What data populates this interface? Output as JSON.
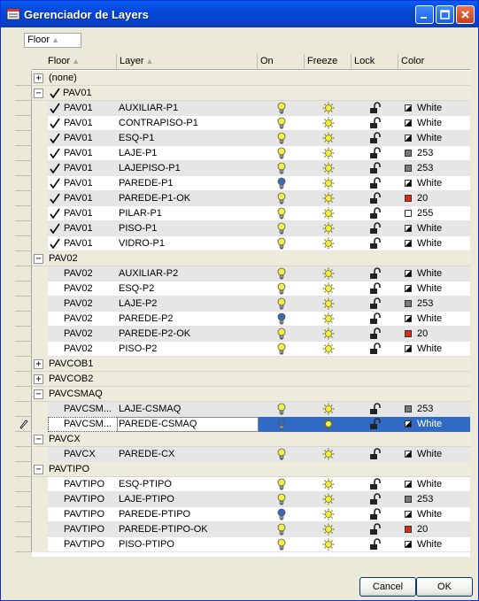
{
  "window": {
    "title": "Gerenciador de Layers"
  },
  "groupby": {
    "label": "Floor"
  },
  "columns": [
    "Floor",
    "Layer",
    "On",
    "Freeze",
    "Lock",
    "Color"
  ],
  "colors": {
    "titlebar": "#0a5cf0",
    "selection": "#316ac5",
    "bulb_on": "#f5f040",
    "bulb_off": "#2f6db8",
    "freeze": "#f5f040",
    "red": "#e02a10",
    "gray": "#7a7a7a"
  },
  "groups": [
    {
      "name": "(none)",
      "expanded": false,
      "checked": false,
      "rows": []
    },
    {
      "name": "PAV01",
      "expanded": true,
      "checked": true,
      "rows": [
        {
          "floor": "PAV01",
          "layer": "AUXILIAR-P1",
          "on": true,
          "color": "White",
          "swatch": "white"
        },
        {
          "floor": "PAV01",
          "layer": "CONTRAPISO-P1",
          "on": true,
          "color": "White",
          "swatch": "white"
        },
        {
          "floor": "PAV01",
          "layer": "ESQ-P1",
          "on": true,
          "color": "White",
          "swatch": "white"
        },
        {
          "floor": "PAV01",
          "layer": "LAJE-P1",
          "on": true,
          "color": "253",
          "swatch": "gray"
        },
        {
          "floor": "PAV01",
          "layer": "LAJEPISO-P1",
          "on": true,
          "color": "253",
          "swatch": "gray"
        },
        {
          "floor": "PAV01",
          "layer": "PAREDE-P1",
          "on": false,
          "color": "White",
          "swatch": "white"
        },
        {
          "floor": "PAV01",
          "layer": "PAREDE-P1-OK",
          "on": true,
          "color": "20",
          "swatch": "red"
        },
        {
          "floor": "PAV01",
          "layer": "PILAR-P1",
          "on": true,
          "color": "255",
          "swatch": "plain"
        },
        {
          "floor": "PAV01",
          "layer": "PISO-P1",
          "on": true,
          "color": "White",
          "swatch": "white"
        },
        {
          "floor": "PAV01",
          "layer": "VIDRO-P1",
          "on": true,
          "color": "White",
          "swatch": "white"
        }
      ]
    },
    {
      "name": "PAV02",
      "expanded": true,
      "checked": false,
      "rows": [
        {
          "floor": "PAV02",
          "layer": "AUXILIAR-P2",
          "on": true,
          "color": "White",
          "swatch": "white"
        },
        {
          "floor": "PAV02",
          "layer": "ESQ-P2",
          "on": true,
          "color": "White",
          "swatch": "white"
        },
        {
          "floor": "PAV02",
          "layer": "LAJE-P2",
          "on": true,
          "color": "253",
          "swatch": "gray"
        },
        {
          "floor": "PAV02",
          "layer": "PAREDE-P2",
          "on": false,
          "color": "White",
          "swatch": "white"
        },
        {
          "floor": "PAV02",
          "layer": "PAREDE-P2-OK",
          "on": true,
          "color": "20",
          "swatch": "red"
        },
        {
          "floor": "PAV02",
          "layer": "PISO-P2",
          "on": true,
          "color": "White",
          "swatch": "white"
        }
      ]
    },
    {
      "name": "PAVCOB1",
      "expanded": false,
      "checked": false,
      "rows": []
    },
    {
      "name": "PAVCOB2",
      "expanded": false,
      "checked": false,
      "rows": []
    },
    {
      "name": "PAVCSMAQ",
      "expanded": true,
      "checked": false,
      "rows": [
        {
          "floor": "PAVCSM...",
          "layer": "LAJE-CSMAQ",
          "on": true,
          "color": "253",
          "swatch": "gray"
        },
        {
          "floor": "PAVCSM...",
          "layer": "PAREDE-CSMAQ",
          "on": false,
          "color": "White",
          "swatch": "white",
          "selected": true
        }
      ]
    },
    {
      "name": "PAVCX",
      "expanded": true,
      "checked": false,
      "rows": [
        {
          "floor": "PAVCX",
          "layer": "PAREDE-CX",
          "on": true,
          "color": "White",
          "swatch": "white"
        }
      ]
    },
    {
      "name": "PAVTIPO",
      "expanded": true,
      "checked": false,
      "rows": [
        {
          "floor": "PAVTIPO",
          "layer": "ESQ-PTIPO",
          "on": true,
          "color": "White",
          "swatch": "white"
        },
        {
          "floor": "PAVTIPO",
          "layer": "LAJE-PTIPO",
          "on": true,
          "color": "253",
          "swatch": "gray"
        },
        {
          "floor": "PAVTIPO",
          "layer": "PAREDE-PTIPO",
          "on": false,
          "color": "White",
          "swatch": "white"
        },
        {
          "floor": "PAVTIPO",
          "layer": "PAREDE-PTIPO-OK",
          "on": true,
          "color": "20",
          "swatch": "red"
        },
        {
          "floor": "PAVTIPO",
          "layer": "PISO-PTIPO",
          "on": true,
          "color": "White",
          "swatch": "white"
        }
      ]
    }
  ],
  "buttons": {
    "cancel": "Cancel",
    "ok": "OK"
  }
}
